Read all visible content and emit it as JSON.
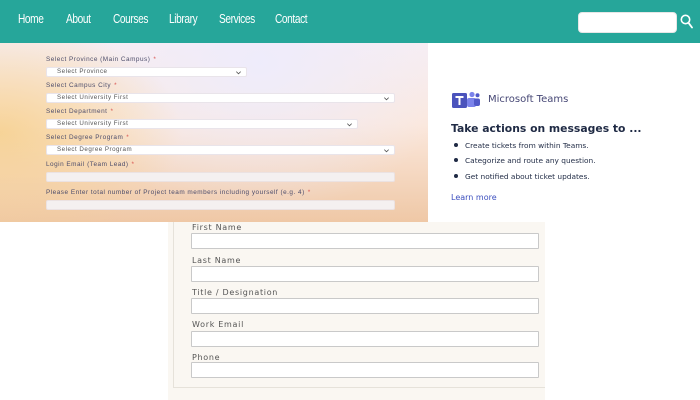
{
  "nav": {
    "items": [
      "Home",
      "About",
      "Courses",
      "Library",
      "Services",
      "Contact"
    ],
    "search_placeholder": "",
    "icon": "search-icon",
    "color": "#26a69a"
  },
  "registration_form": {
    "fields": [
      {
        "label": "Select Province (Main Campus)",
        "required": "*",
        "value": "Select Province"
      },
      {
        "label": "Select Campus City",
        "required": "*",
        "value": "Select University First"
      },
      {
        "label": "Select Department",
        "required": "*",
        "value": "Select University First"
      },
      {
        "label": "Select Degree Program",
        "required": "*",
        "value": "Select Degree Program"
      },
      {
        "label": "Login Email (Team Lead)",
        "required": "*",
        "value": ""
      },
      {
        "label": "Please Enter total number of Project team members including yourself (e.g. 4)",
        "required": "*",
        "value": ""
      }
    ]
  },
  "teams_card": {
    "product": "Microsoft Teams",
    "heading": "Take actions on messages to ...",
    "bullets": [
      "Create tickets from within Teams.",
      "Categorize and route any question.",
      "Get notified about ticket updates."
    ],
    "link": "Learn more",
    "icon": "teams-logo-icon",
    "color": "#464775"
  },
  "contact_form": {
    "fields": [
      {
        "label": "First Name",
        "value": ""
      },
      {
        "label": "Last Name",
        "value": ""
      },
      {
        "label": "Title / Designation",
        "value": ""
      },
      {
        "label": "Work Email",
        "value": ""
      },
      {
        "label": "Phone",
        "value": ""
      }
    ]
  }
}
